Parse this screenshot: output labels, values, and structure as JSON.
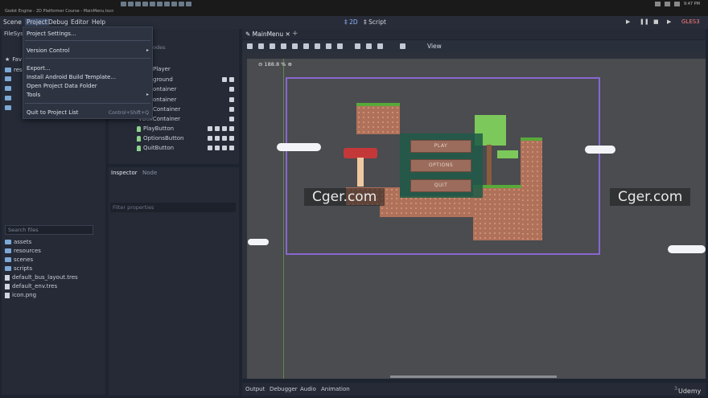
{
  "titlebar": {
    "title": "Godot Engine - 2D Platformer Course - MainMenu.tscn",
    "time": "9:47 PM"
  },
  "menubar": {
    "items": [
      "Scene",
      "Project",
      "Debug",
      "Editor",
      "Help"
    ],
    "workspace": [
      "2D",
      "Script"
    ],
    "renderer": "GLES3"
  },
  "project_menu": {
    "items": [
      "Project Settings...",
      "Version Control",
      "Export...",
      "Install Android Build Template...",
      "Open Project Data Folder",
      "Tools",
      "Quit to Project List"
    ],
    "shortcut": "Control+Shift+Q"
  },
  "filesystem": {
    "title": "FileSys",
    "favorites": "Fav",
    "res": "res",
    "search_placeholder": "Search files",
    "items": [
      "assets",
      "resources",
      "scenes",
      "scripts",
      "default_bus_layout.tres",
      "default_env.tres",
      "icon.png"
    ]
  },
  "scene": {
    "filter_placeholder": "odes",
    "nodes": [
      "Player",
      "ground",
      "ontainer",
      "ontainer",
      "Container",
      "VBoxContainer",
      "PlayButton",
      "OptionsButton",
      "QuitButton"
    ]
  },
  "inspector": {
    "tabs": [
      "Inspector",
      "Node"
    ],
    "filter_placeholder": "Filter properties"
  },
  "viewport": {
    "tab": "MainMenu",
    "view_label": "View",
    "zoom": "188.8 %",
    "buttons": [
      "PLAY",
      "OPTIONS",
      "QUIT"
    ],
    "watermark": "Cger.com"
  },
  "bottom": {
    "items": [
      "Output",
      "Debugger",
      "Audio",
      "Animation"
    ],
    "version": "3.",
    "udemy": "Udemy"
  }
}
